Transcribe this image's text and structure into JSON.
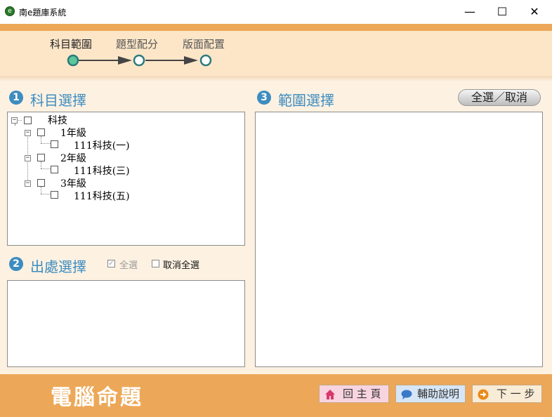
{
  "window": {
    "title": "南e題庫系統",
    "minimize": "—",
    "maximize": "☐",
    "close": "✕"
  },
  "wizard": {
    "steps": [
      {
        "label": "科目範圍",
        "active": true
      },
      {
        "label": "題型配分",
        "active": false
      },
      {
        "label": "版面配置",
        "active": false
      }
    ]
  },
  "subject": {
    "number": "1",
    "title": "科目選擇",
    "tree": [
      {
        "label": "科技",
        "level": 0,
        "expander": "−"
      },
      {
        "label": "1年級",
        "level": 1,
        "expander": "−"
      },
      {
        "label": "111科技(一)",
        "level": 2
      },
      {
        "label": "2年級",
        "level": 1,
        "expander": "−"
      },
      {
        "label": "111科技(三)",
        "level": 2
      },
      {
        "label": "3年級",
        "level": 1,
        "expander": "−"
      },
      {
        "label": "111科技(五)",
        "level": 2
      }
    ]
  },
  "source": {
    "number": "2",
    "title": "出處選擇",
    "select_all": {
      "label": "全選",
      "checked": true,
      "disabled": true
    },
    "deselect_all": {
      "label": "取消全選",
      "checked": false
    }
  },
  "range": {
    "number": "3",
    "title": "範圍選擇",
    "toggle_button": "全選／取消"
  },
  "footer": {
    "title": "電腦命題",
    "home_button": "回 主 頁",
    "help_button": "輔助說明",
    "next_button": "下 一 步"
  },
  "colors": {
    "accent_orange": "#eca858",
    "section_blue": "#3d8dc0",
    "step_active": "#5cc79a",
    "step_teal": "#2c7b7b"
  }
}
